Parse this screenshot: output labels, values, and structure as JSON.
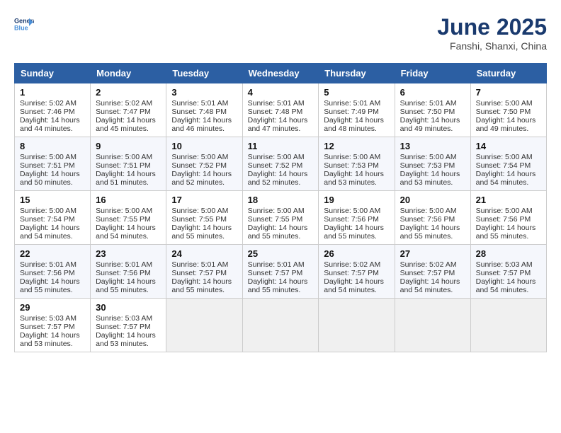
{
  "logo": {
    "line1": "General",
    "line2": "Blue"
  },
  "title": "June 2025",
  "subtitle": "Fanshi, Shanxi, China",
  "headers": [
    "Sunday",
    "Monday",
    "Tuesday",
    "Wednesday",
    "Thursday",
    "Friday",
    "Saturday"
  ],
  "weeks": [
    [
      {
        "day": "1",
        "sunrise": "Sunrise: 5:02 AM",
        "sunset": "Sunset: 7:46 PM",
        "daylight": "Daylight: 14 hours and 44 minutes."
      },
      {
        "day": "2",
        "sunrise": "Sunrise: 5:02 AM",
        "sunset": "Sunset: 7:47 PM",
        "daylight": "Daylight: 14 hours and 45 minutes."
      },
      {
        "day": "3",
        "sunrise": "Sunrise: 5:01 AM",
        "sunset": "Sunset: 7:48 PM",
        "daylight": "Daylight: 14 hours and 46 minutes."
      },
      {
        "day": "4",
        "sunrise": "Sunrise: 5:01 AM",
        "sunset": "Sunset: 7:48 PM",
        "daylight": "Daylight: 14 hours and 47 minutes."
      },
      {
        "day": "5",
        "sunrise": "Sunrise: 5:01 AM",
        "sunset": "Sunset: 7:49 PM",
        "daylight": "Daylight: 14 hours and 48 minutes."
      },
      {
        "day": "6",
        "sunrise": "Sunrise: 5:01 AM",
        "sunset": "Sunset: 7:50 PM",
        "daylight": "Daylight: 14 hours and 49 minutes."
      },
      {
        "day": "7",
        "sunrise": "Sunrise: 5:00 AM",
        "sunset": "Sunset: 7:50 PM",
        "daylight": "Daylight: 14 hours and 49 minutes."
      }
    ],
    [
      {
        "day": "8",
        "sunrise": "Sunrise: 5:00 AM",
        "sunset": "Sunset: 7:51 PM",
        "daylight": "Daylight: 14 hours and 50 minutes."
      },
      {
        "day": "9",
        "sunrise": "Sunrise: 5:00 AM",
        "sunset": "Sunset: 7:51 PM",
        "daylight": "Daylight: 14 hours and 51 minutes."
      },
      {
        "day": "10",
        "sunrise": "Sunrise: 5:00 AM",
        "sunset": "Sunset: 7:52 PM",
        "daylight": "Daylight: 14 hours and 52 minutes."
      },
      {
        "day": "11",
        "sunrise": "Sunrise: 5:00 AM",
        "sunset": "Sunset: 7:52 PM",
        "daylight": "Daylight: 14 hours and 52 minutes."
      },
      {
        "day": "12",
        "sunrise": "Sunrise: 5:00 AM",
        "sunset": "Sunset: 7:53 PM",
        "daylight": "Daylight: 14 hours and 53 minutes."
      },
      {
        "day": "13",
        "sunrise": "Sunrise: 5:00 AM",
        "sunset": "Sunset: 7:53 PM",
        "daylight": "Daylight: 14 hours and 53 minutes."
      },
      {
        "day": "14",
        "sunrise": "Sunrise: 5:00 AM",
        "sunset": "Sunset: 7:54 PM",
        "daylight": "Daylight: 14 hours and 54 minutes."
      }
    ],
    [
      {
        "day": "15",
        "sunrise": "Sunrise: 5:00 AM",
        "sunset": "Sunset: 7:54 PM",
        "daylight": "Daylight: 14 hours and 54 minutes."
      },
      {
        "day": "16",
        "sunrise": "Sunrise: 5:00 AM",
        "sunset": "Sunset: 7:55 PM",
        "daylight": "Daylight: 14 hours and 54 minutes."
      },
      {
        "day": "17",
        "sunrise": "Sunrise: 5:00 AM",
        "sunset": "Sunset: 7:55 PM",
        "daylight": "Daylight: 14 hours and 55 minutes."
      },
      {
        "day": "18",
        "sunrise": "Sunrise: 5:00 AM",
        "sunset": "Sunset: 7:55 PM",
        "daylight": "Daylight: 14 hours and 55 minutes."
      },
      {
        "day": "19",
        "sunrise": "Sunrise: 5:00 AM",
        "sunset": "Sunset: 7:56 PM",
        "daylight": "Daylight: 14 hours and 55 minutes."
      },
      {
        "day": "20",
        "sunrise": "Sunrise: 5:00 AM",
        "sunset": "Sunset: 7:56 PM",
        "daylight": "Daylight: 14 hours and 55 minutes."
      },
      {
        "day": "21",
        "sunrise": "Sunrise: 5:00 AM",
        "sunset": "Sunset: 7:56 PM",
        "daylight": "Daylight: 14 hours and 55 minutes."
      }
    ],
    [
      {
        "day": "22",
        "sunrise": "Sunrise: 5:01 AM",
        "sunset": "Sunset: 7:56 PM",
        "daylight": "Daylight: 14 hours and 55 minutes."
      },
      {
        "day": "23",
        "sunrise": "Sunrise: 5:01 AM",
        "sunset": "Sunset: 7:56 PM",
        "daylight": "Daylight: 14 hours and 55 minutes."
      },
      {
        "day": "24",
        "sunrise": "Sunrise: 5:01 AM",
        "sunset": "Sunset: 7:57 PM",
        "daylight": "Daylight: 14 hours and 55 minutes."
      },
      {
        "day": "25",
        "sunrise": "Sunrise: 5:01 AM",
        "sunset": "Sunset: 7:57 PM",
        "daylight": "Daylight: 14 hours and 55 minutes."
      },
      {
        "day": "26",
        "sunrise": "Sunrise: 5:02 AM",
        "sunset": "Sunset: 7:57 PM",
        "daylight": "Daylight: 14 hours and 54 minutes."
      },
      {
        "day": "27",
        "sunrise": "Sunrise: 5:02 AM",
        "sunset": "Sunset: 7:57 PM",
        "daylight": "Daylight: 14 hours and 54 minutes."
      },
      {
        "day": "28",
        "sunrise": "Sunrise: 5:03 AM",
        "sunset": "Sunset: 7:57 PM",
        "daylight": "Daylight: 14 hours and 54 minutes."
      }
    ],
    [
      {
        "day": "29",
        "sunrise": "Sunrise: 5:03 AM",
        "sunset": "Sunset: 7:57 PM",
        "daylight": "Daylight: 14 hours and 53 minutes."
      },
      {
        "day": "30",
        "sunrise": "Sunrise: 5:03 AM",
        "sunset": "Sunset: 7:57 PM",
        "daylight": "Daylight: 14 hours and 53 minutes."
      },
      null,
      null,
      null,
      null,
      null
    ]
  ]
}
